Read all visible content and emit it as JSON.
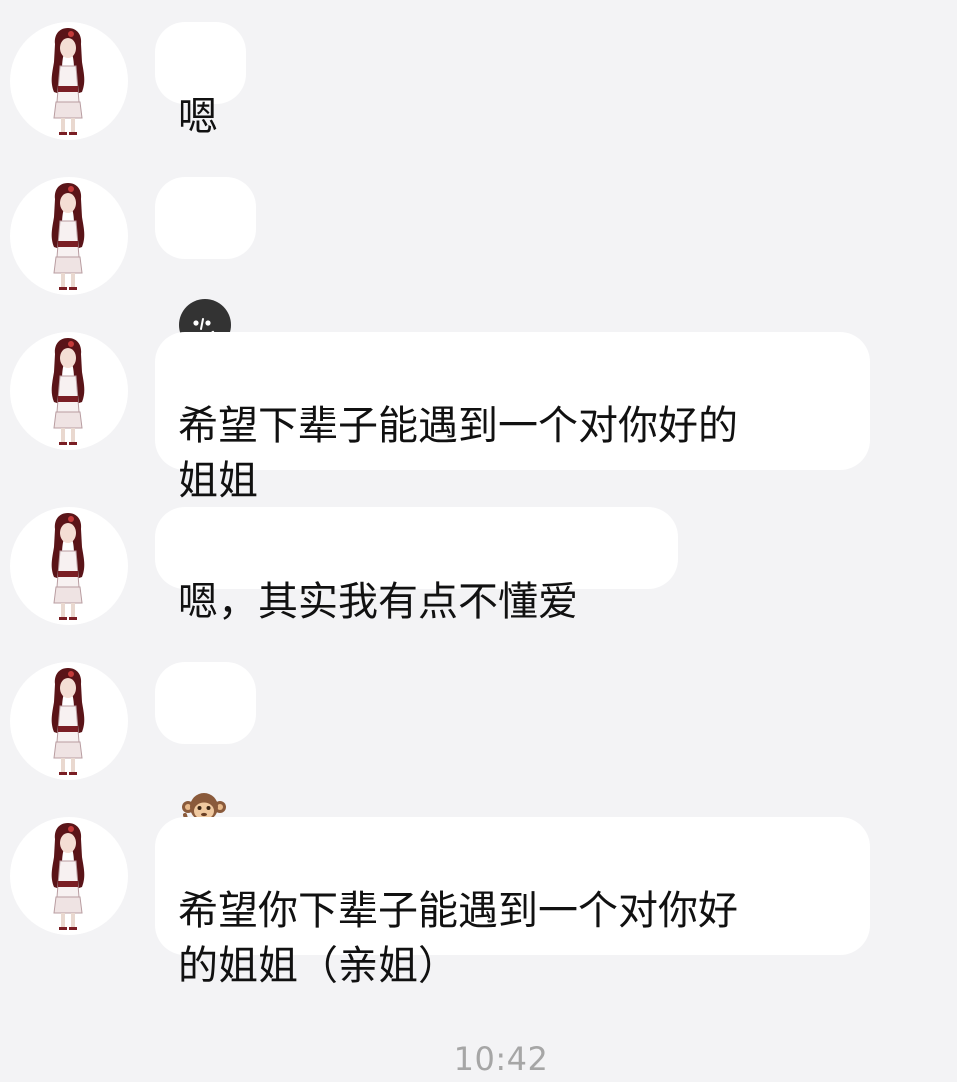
{
  "chat": {
    "messages": [
      {
        "text": "嗯",
        "suffix_icon": "",
        "type": "text"
      },
      {
        "text": "",
        "suffix_icon": "dark-smirk-face-icon",
        "type": "emoji"
      },
      {
        "text": "希望下辈子能遇到一个对你好的\n姐姐",
        "suffix_icon": "dark-smirk-face-icon",
        "type": "text"
      },
      {
        "text": "嗯，其实我有点不懂爱",
        "suffix_icon": "",
        "type": "text"
      },
      {
        "text": "",
        "suffix_icon": "monkey-icon",
        "type": "emoji"
      },
      {
        "text": "希望你下辈子能遇到一个对你好\n的姐姐（亲姐）",
        "suffix_icon": "",
        "type": "text"
      }
    ],
    "timestamp": "10:42"
  },
  "colors": {
    "background": "#f3f3f5",
    "bubble": "#ffffff",
    "text": "#111111",
    "timestamp": "#a6a6a6",
    "emoji_face": "#333333",
    "avatar_hair": "#5a1418"
  }
}
